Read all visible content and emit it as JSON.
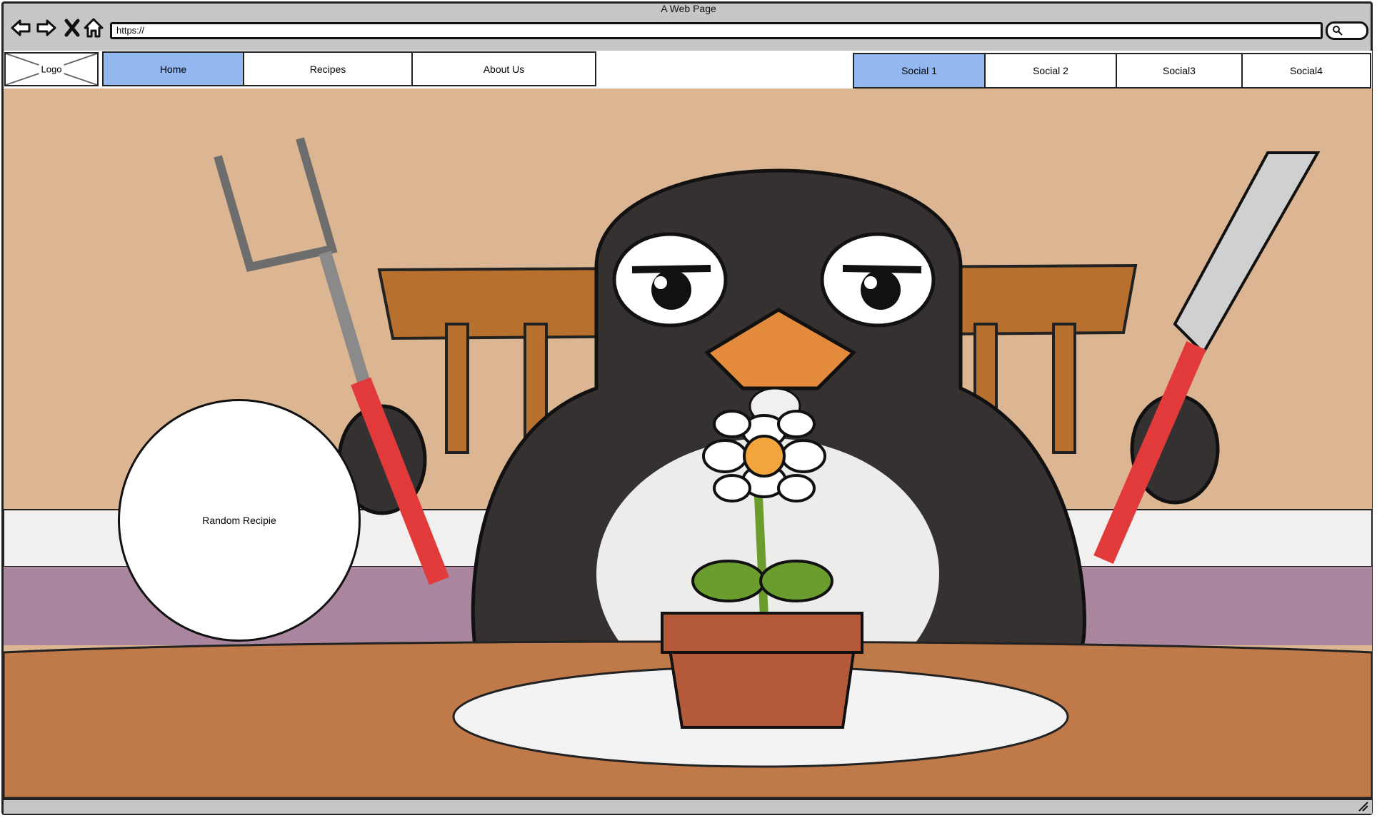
{
  "browser": {
    "title": "A Web Page",
    "url": "https://",
    "buttons": [
      "back-icon",
      "forward-icon",
      "close-icon",
      "home-icon"
    ]
  },
  "logo": {
    "label": "Logo"
  },
  "nav": {
    "tabs": [
      {
        "label": "Home",
        "active": true
      },
      {
        "label": "Recipes",
        "active": false
      },
      {
        "label": "About Us",
        "active": false
      }
    ],
    "social": [
      {
        "label": "Social 1",
        "active": true
      },
      {
        "label": "Social 2",
        "active": false
      },
      {
        "label": "Social3",
        "active": false
      },
      {
        "label": "Social4",
        "active": false
      }
    ]
  },
  "hero": {
    "random_button": "Random Recipie",
    "illustration": "penguin-at-table-illustration"
  },
  "colors": {
    "active_tab": "#93b8f0",
    "wall": "#dcb592",
    "table": "#c07a4a",
    "penguin": "#353130"
  }
}
